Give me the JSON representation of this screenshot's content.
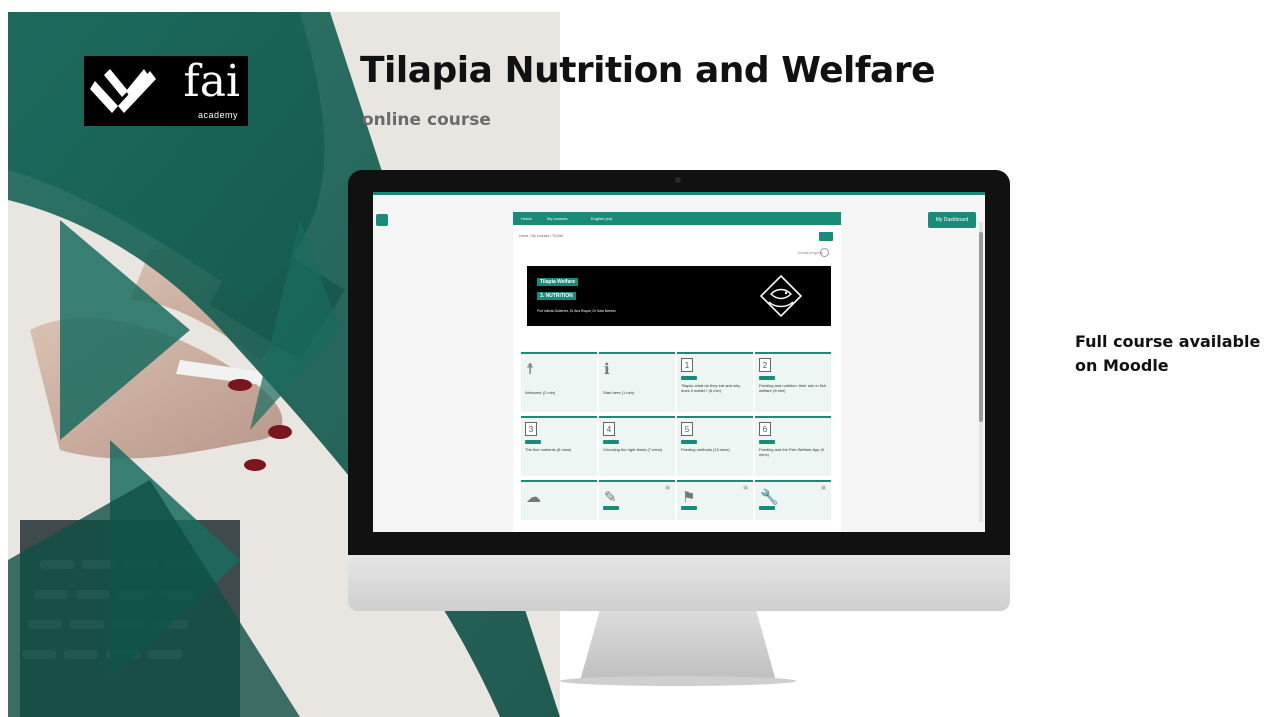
{
  "brand": {
    "wordmark": "fai",
    "sub": "academy"
  },
  "slide": {
    "title": "Tilapia Nutrition and Welfare",
    "subtitle": "online course",
    "side_note_line1": "Full course available",
    "side_note_line2": "on Moodle"
  },
  "colors": {
    "brand_green": "#1a6b5f",
    "accent_teal": "#1a8b78"
  },
  "moodle": {
    "nav": [
      "Home",
      "My courses",
      "English (en)"
    ],
    "dashboard_button": "My Dashboard",
    "breadcrumb": "Home / My courses / TILNW",
    "progress_label": "Overall progress",
    "banner": {
      "line1": "Tilapia Welfare",
      "line2": "3. NUTRITION",
      "authors": "Prof Iolinda Gutierrez, Dr Ana Roque, Dr Sara Barreto"
    },
    "tiles": [
      {
        "icon": "person-icon",
        "number": "",
        "chip": false,
        "text": "Welcome (2 min)"
      },
      {
        "icon": "info-icon",
        "number": "",
        "chip": false,
        "text": "Start here (1 min)"
      },
      {
        "icon": "",
        "number": "1",
        "chip": true,
        "text": "Tilapia: what do they eat and why does it matter? (6 min)"
      },
      {
        "icon": "",
        "number": "2",
        "chip": true,
        "text": "Feeding and nutrition: their role in fish welfare (8 min)"
      },
      {
        "icon": "",
        "number": "3",
        "chip": true,
        "text": "The five nutrients (8 mins)"
      },
      {
        "icon": "",
        "number": "4",
        "chip": true,
        "text": "Choosing the right feeds (7 mins)"
      },
      {
        "icon": "",
        "number": "5",
        "chip": true,
        "text": "Feeding methods (15 mins)"
      },
      {
        "icon": "",
        "number": "6",
        "chip": true,
        "text": "Feeding and the Fish Welfare App (9 mins)"
      },
      {
        "icon": "cloud-icon",
        "number": "",
        "chip": false,
        "text": ""
      },
      {
        "icon": "pencil-icon",
        "number": "",
        "chip": true,
        "text": ""
      },
      {
        "icon": "graduation-icon",
        "number": "",
        "chip": true,
        "text": ""
      },
      {
        "icon": "wrench-icon",
        "number": "",
        "chip": true,
        "text": ""
      }
    ]
  }
}
